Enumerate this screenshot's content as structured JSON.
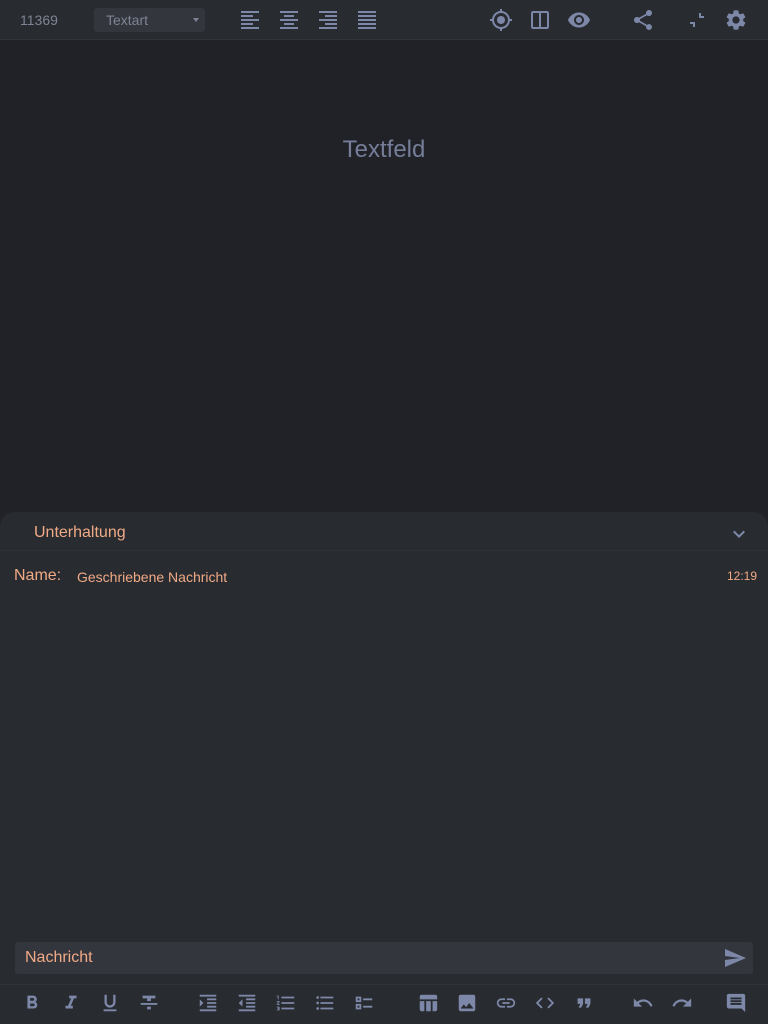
{
  "toolbar": {
    "doc_id": "11369",
    "text_type": "Textart",
    "icons": [
      "align-left-icon",
      "align-center-icon",
      "align-right-icon",
      "align-justify-icon",
      "crosshair-icon",
      "split-view-icon",
      "eye-icon",
      "share-icon",
      "fullscreen-exit-icon",
      "gear-icon"
    ]
  },
  "editor": {
    "placeholder": "Textfeld"
  },
  "conversation": {
    "title": "Unterhaltung",
    "messages": [
      {
        "sender": "Name:",
        "text": "Geschriebene Nachricht",
        "time": "12:19"
      }
    ],
    "input_placeholder": "Nachricht"
  },
  "format_toolbar": {
    "icons": [
      "bold-icon",
      "italic-icon",
      "underline-icon",
      "strikethrough-icon",
      "indent-increase-icon",
      "indent-decrease-icon",
      "numbered-list-icon",
      "bullet-list-icon",
      "checklist-icon",
      "table-icon",
      "image-icon",
      "link-icon",
      "code-icon",
      "quote-icon",
      "undo-icon",
      "redo-icon",
      "comment-icon"
    ]
  },
  "colors": {
    "background": "#212227",
    "panel": "#282b30",
    "accent": "#f1aa86",
    "icon": "#7d88a8"
  }
}
